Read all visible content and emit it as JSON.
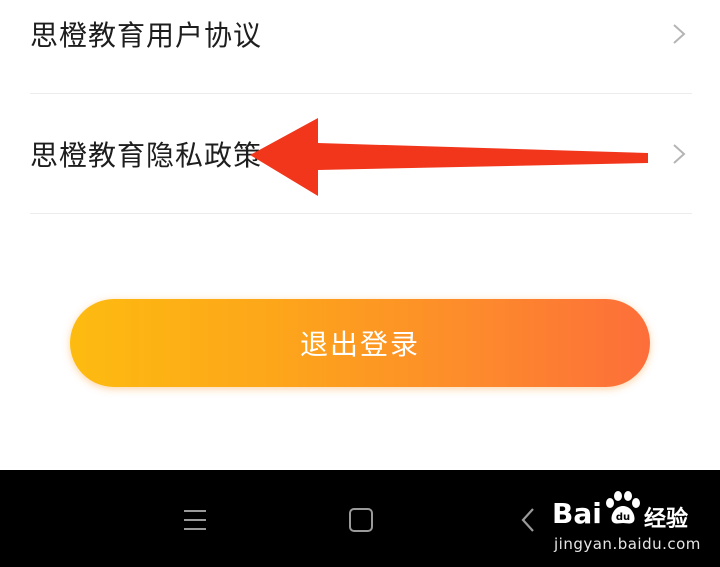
{
  "settings": {
    "items": [
      {
        "label": "思橙教育用户协议"
      },
      {
        "label": "思橙教育隐私政策"
      }
    ]
  },
  "logout": {
    "label": "退出登录"
  },
  "colors": {
    "accent_start": "#fdbb10",
    "accent_end": "#fd6e3a",
    "annotation_arrow": "#f2361c",
    "navbar": "#000000"
  },
  "navbar": {
    "icons": [
      "menu-icon",
      "home-square-icon",
      "back-chevron-icon"
    ]
  },
  "watermark": {
    "brand": "Bai",
    "brand_suffix": "经验",
    "url": "jingyan.baidu.com"
  }
}
